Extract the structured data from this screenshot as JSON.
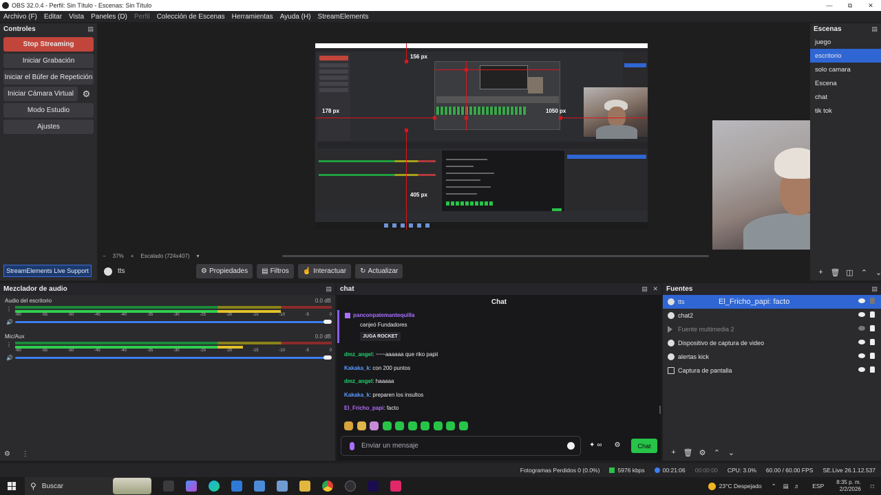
{
  "window": {
    "title": "OBS 32.0.4 - Perfil: Sin Título - Escenas: Sin Título",
    "controls": [
      "minimize",
      "restore",
      "close"
    ]
  },
  "menu": {
    "items": [
      "Archivo (F)",
      "Editar",
      "Vista",
      "Paneles (D)",
      "Perfil",
      "Colección de Escenas",
      "Herramientas",
      "Ayuda (H)",
      "StreamElements"
    ]
  },
  "controls_panel": {
    "title": "Controles",
    "stop_streaming": "Stop Streaming",
    "start_recording": "Iniciar Grabación",
    "replay_buffer": "Iniciar el Búfer de Repetición",
    "virtual_camera": "Iniciar Cámara Virtual",
    "studio_mode": "Modo Estudio",
    "settings": "Ajustes",
    "se_support": "StreamElements Live Support"
  },
  "preview": {
    "guides": {
      "top": "156 px",
      "left": "178 px",
      "right": "1050 px",
      "bottom": "405 px"
    },
    "zoom": "37%",
    "scaling": "Escalado (724x407)"
  },
  "context_bar": {
    "source": "tts",
    "properties": "Propiedades",
    "filters": "Filtros",
    "interact": "Interactuar",
    "refresh": "Actualizar"
  },
  "scenes": {
    "title": "Escenas",
    "items": [
      "juego",
      "escritorio",
      "solo camara",
      "Escena",
      "chat",
      "tik tok"
    ],
    "selected": "escritorio"
  },
  "mixer": {
    "title": "Mezclador de audio",
    "scale": [
      "-60",
      "-55",
      "-50",
      "-45",
      "-40",
      "-35",
      "-30",
      "-25",
      "-20",
      "-15",
      "-10",
      "-5",
      "0"
    ],
    "tracks": [
      {
        "name": "Audio del escritorio",
        "db": "0.0 dB",
        "level": 0.84
      },
      {
        "name": "Mic/Aux",
        "db": "0.0 dB",
        "level": 0.72
      }
    ]
  },
  "chat": {
    "panel_title": "chat",
    "header": "Chat",
    "sub": {
      "user": "panconpatemantequilla",
      "text": "canjeó Fundadores",
      "reward": "JUGA ROCKET"
    },
    "messages": [
      {
        "user": "dmz_angel",
        "text": "~~~aaaaaa que riko papii",
        "color": "#1fd46d"
      },
      {
        "user": "Kakaka_k",
        "text": "con 200 puntos",
        "color": "#5c9cff"
      },
      {
        "user": "dmz_angel",
        "text": "haaaaa",
        "color": "#1fd46d"
      },
      {
        "user": "Kakaka_k",
        "text": "preparen los insultos",
        "color": "#5c9cff"
      },
      {
        "user": "El_Fricho_papi",
        "text": "facto",
        "color": "#b16cf5"
      }
    ],
    "input_placeholder": "Enviar un mensaje",
    "points": "∞",
    "send": "Chat"
  },
  "sources": {
    "title": "Fuentes",
    "items": [
      {
        "name": "tts",
        "icon": "globe-icon",
        "visible": true,
        "locked": false
      },
      {
        "name": "chat2",
        "icon": "globe-icon",
        "visible": true,
        "locked": true
      },
      {
        "name": "Fuente multimedia 2",
        "icon": "play-icon",
        "visible": false,
        "locked": true
      },
      {
        "name": "Dispositivo de captura de video",
        "icon": "camera-icon",
        "visible": true,
        "locked": true
      },
      {
        "name": "alertas kick",
        "icon": "globe-icon",
        "visible": true,
        "locked": true
      },
      {
        "name": "Captura de pantalla",
        "icon": "monitor-icon",
        "visible": true,
        "locked": true
      }
    ],
    "overlay": "El_Fricho_papi: facto"
  },
  "status": {
    "dropped": "Fotogramas Perdidos 0 (0.0%)",
    "bitrate": "5976 kbps",
    "live_time": "00:21:06",
    "rec_time": "00:00:00",
    "cpu": "CPU: 3.0%",
    "fps": "60.00 / 60.00 FPS",
    "se_version": "SE.Live 26.1.12.537"
  },
  "taskbar": {
    "search": "Buscar",
    "weather": "23°C  Despejado",
    "lang": "ESP",
    "time": "8:35 p. m.",
    "date": "2/2/2026"
  },
  "colors": {
    "accent": "#2f66d4",
    "stop": "#c2453b",
    "guide": "#e0131b",
    "kick_green": "#26c448"
  }
}
